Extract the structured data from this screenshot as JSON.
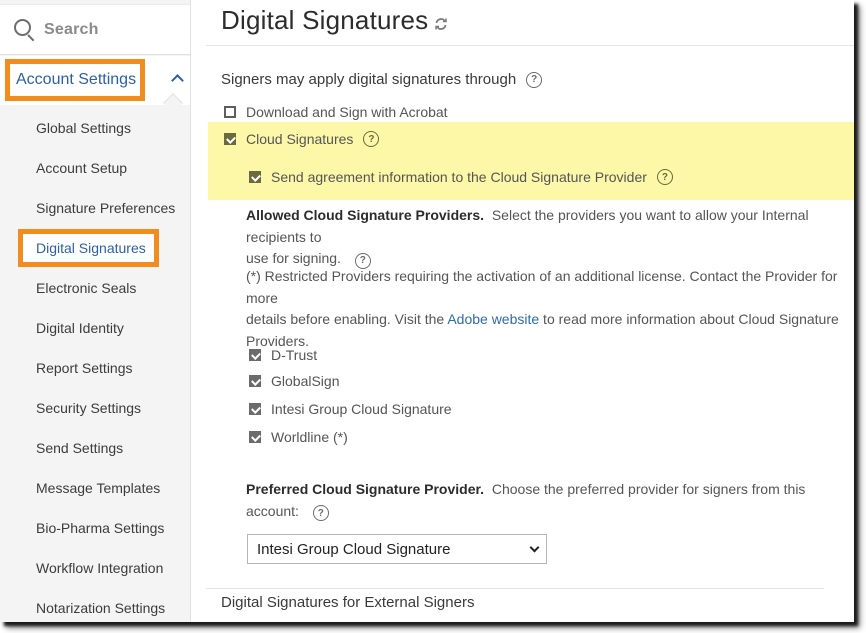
{
  "sidebar": {
    "search_label": "Search",
    "section_label": "Account Settings",
    "items": [
      {
        "label": "Global Settings"
      },
      {
        "label": "Account Setup"
      },
      {
        "label": "Signature Preferences"
      },
      {
        "label": "Digital Signatures",
        "active": true
      },
      {
        "label": "Electronic Seals"
      },
      {
        "label": "Digital Identity"
      },
      {
        "label": "Report Settings"
      },
      {
        "label": "Security Settings"
      },
      {
        "label": "Send Settings"
      },
      {
        "label": "Message Templates"
      },
      {
        "label": "Bio-Pharma Settings"
      },
      {
        "label": "Workflow Integration"
      },
      {
        "label": "Notarization Settings"
      }
    ]
  },
  "main": {
    "title": "Digital Signatures",
    "signers_label": "Signers may apply digital signatures through",
    "options": {
      "download_acrobat": {
        "label": "Download and Sign with Acrobat",
        "checked": false
      },
      "cloud_signatures": {
        "label": "Cloud Signatures",
        "checked": true
      },
      "send_agreement_info": {
        "label": "Send agreement information to the Cloud Signature Provider",
        "checked": true
      }
    },
    "allowed": {
      "heading": "Allowed Cloud Signature Providers.",
      "text_line1": "Select the providers you want to allow your Internal recipients to",
      "text_line2": "use for signing."
    },
    "restricted": {
      "line1": "(*) Restricted Providers requiring the activation of an additional license. Contact the Provider for more",
      "line2_pre": "details before enabling. Visit the ",
      "link": "Adobe website",
      "line2_post": " to read more information about Cloud Signature",
      "line3": "Providers."
    },
    "providers": [
      {
        "label": "D-Trust",
        "checked": true
      },
      {
        "label": "GlobalSign",
        "checked": true
      },
      {
        "label": "Intesi Group Cloud Signature",
        "checked": true
      },
      {
        "label": "Worldline (*)",
        "checked": true
      }
    ],
    "preferred": {
      "heading": "Preferred Cloud Signature Provider.",
      "text_line1": "Choose the preferred provider for signers from this",
      "text_line2": "account:",
      "selected": "Intesi Group Cloud Signature"
    },
    "external_title": "Digital Signatures for External Signers"
  },
  "colors": {
    "highlight_box": "#f28c1c",
    "link_blue": "#2d5fa5",
    "yellow_highlight": "#fdf7a8"
  }
}
